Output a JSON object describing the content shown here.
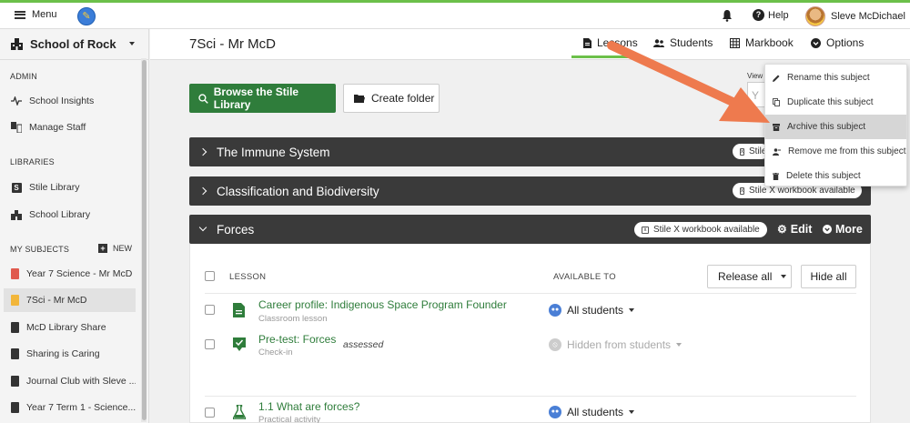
{
  "topbar": {
    "menu_label": "Menu",
    "help_label": "Help",
    "user_name": "Sleve McDichael"
  },
  "sidebar": {
    "school_name": "School of Rock",
    "admin_label": "ADMIN",
    "admin_items": [
      {
        "label": "School Insights",
        "icon": "pulse-icon"
      },
      {
        "label": "Manage Staff",
        "icon": "staff-icon"
      }
    ],
    "libraries_label": "LIBRARIES",
    "library_items": [
      {
        "label": "Stile Library",
        "icon": "stile-logo-icon"
      },
      {
        "label": "School Library",
        "icon": "school-building-icon"
      }
    ],
    "my_subjects_label": "MY SUBJECTS",
    "new_label": "NEW",
    "subjects": [
      {
        "label": "Year 7 Science - Mr McD",
        "color": "#e05a4e"
      },
      {
        "label": "7Sci - Mr McD",
        "color": "#f2b63a",
        "active": true
      },
      {
        "label": "McD Library Share",
        "color": "#333333"
      },
      {
        "label": "Sharing is Caring",
        "color": "#333333"
      },
      {
        "label": "Journal Club with Sleve ...",
        "color": "#333333"
      },
      {
        "label": "Year 7 Term 1 - Science...",
        "color": "#333333"
      }
    ]
  },
  "header": {
    "subject_title": "7Sci - Mr McD",
    "tabs": [
      {
        "label": "Lessons",
        "icon": "document-icon",
        "active": true
      },
      {
        "label": "Students",
        "icon": "users-icon"
      },
      {
        "label": "Markbook",
        "icon": "grid-icon"
      },
      {
        "label": "Options",
        "icon": "chevron-circle-icon"
      }
    ]
  },
  "toolbar": {
    "browse_label": "Browse the Stile Library",
    "create_folder_label": "Create folder",
    "view_label": "View",
    "view_value": "Y"
  },
  "folders": [
    {
      "title": "The Immune System",
      "badge": "Stile X workbook available",
      "expanded": false
    },
    {
      "title": "Classification and Biodiversity",
      "badge": "Stile X workbook available",
      "expanded": false
    },
    {
      "title": "Forces",
      "badge": "Stile X workbook available",
      "expanded": true,
      "edit_label": "Edit",
      "more_label": "More"
    }
  ],
  "lessons_table": {
    "col_lesson": "LESSON",
    "col_available": "AVAILABLE TO",
    "release_all_label": "Release all",
    "hide_all_label": "Hide all",
    "rows": [
      {
        "title": "Career profile: Indigenous Space Program Founder",
        "subtitle": "Classroom lesson",
        "tag": "",
        "available": "All students",
        "icon": "document-icon"
      },
      {
        "title": "Pre-test: Forces",
        "subtitle": "Check-in",
        "tag": "assessed",
        "available": "Hidden from students",
        "icon": "checkin-icon"
      },
      {
        "title": "1.1 What are forces?",
        "subtitle": "Practical activity",
        "tag": "",
        "available": "All students",
        "icon": "flask-icon"
      }
    ]
  },
  "options_menu": {
    "items": [
      {
        "label": "Rename this subject",
        "icon": "pencil-icon"
      },
      {
        "label": "Duplicate this subject",
        "icon": "duplicate-icon"
      },
      {
        "label": "Archive this subject",
        "icon": "archive-icon",
        "highlighted": true
      },
      {
        "label": "Remove me from this subject",
        "icon": "remove-user-icon"
      },
      {
        "label": "Delete this subject",
        "icon": "trash-icon"
      }
    ]
  },
  "colors": {
    "accent_green": "#2f7d3b",
    "top_border": "#6cc04a",
    "folder_bar": "#3a3a3a",
    "annotation_arrow": "#ee7a4e"
  }
}
